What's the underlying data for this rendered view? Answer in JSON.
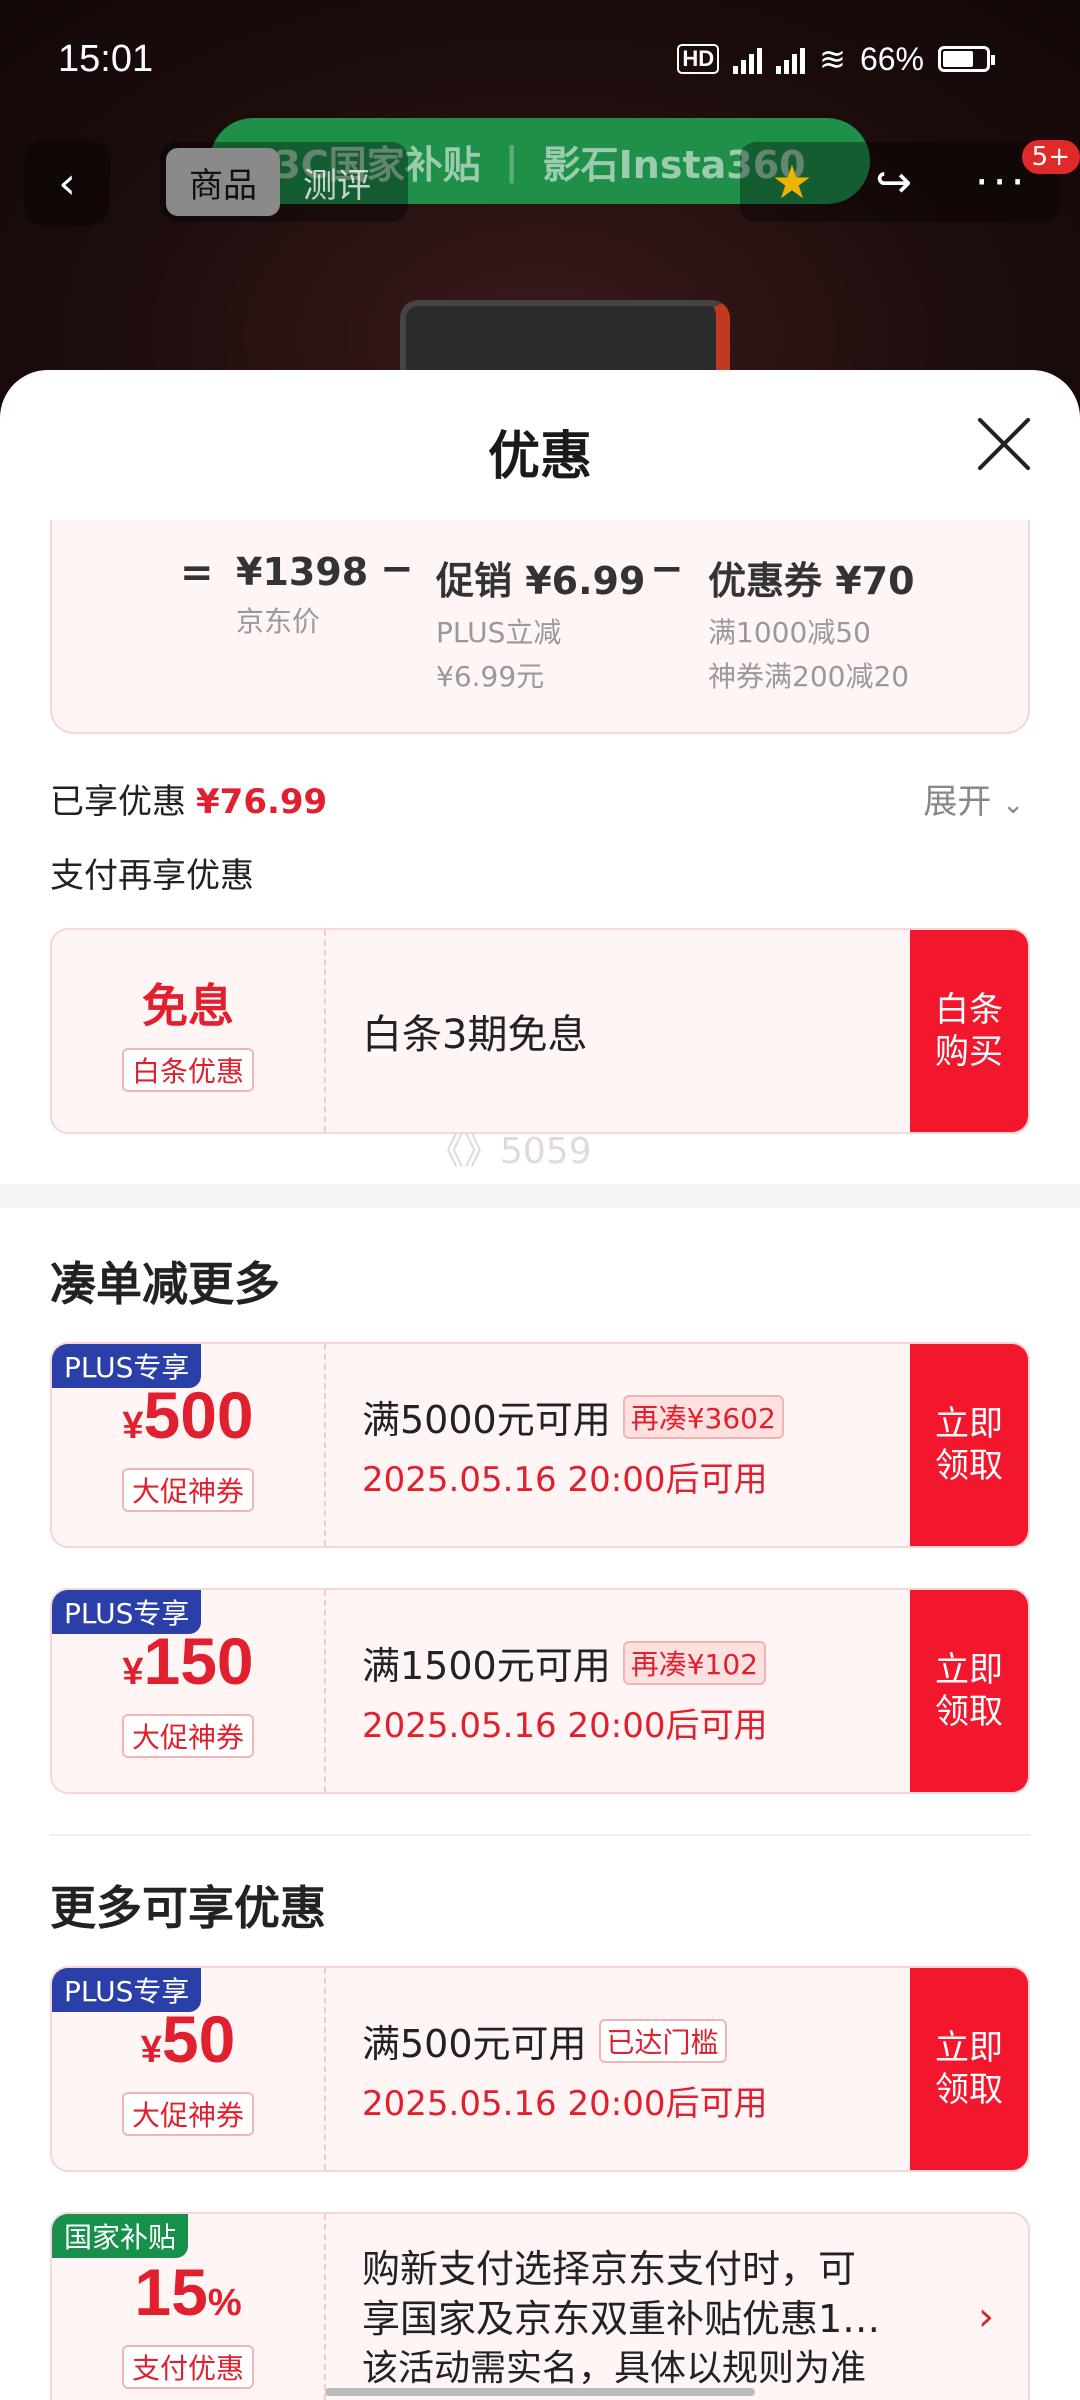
{
  "status_bar": {
    "time": "15:01",
    "battery": "66%"
  },
  "background": {
    "banner_left": "3C国家补贴",
    "banner_right": "影石Insta360",
    "tabs": [
      "商品",
      "测评"
    ],
    "badge": "5+"
  },
  "sheet": {
    "title": "优惠",
    "calc": {
      "eq": "=",
      "price": {
        "value": "¥1398",
        "label": "京东价"
      },
      "promo": {
        "value": "促销 ¥6.99",
        "label1": "PLUS立减",
        "label2": "¥6.99元"
      },
      "coupon": {
        "value": "优惠券 ¥70",
        "label1": "满1000减50",
        "label2": "神券满200减20"
      },
      "minus": "−"
    },
    "enjoyed": {
      "label": "已享优惠",
      "amount": "¥76.99",
      "expand": "展开"
    },
    "pay_title": "支付再享优惠",
    "baitiao": {
      "main": "免息",
      "tag": "白条优惠",
      "desc": "白条3期免息",
      "action": "白条购买"
    },
    "watermark": "《》5059",
    "section1": "凑单减更多",
    "coupons": [
      {
        "plus": "PLUS专享",
        "cur": "¥",
        "amount": "500",
        "tag": "大促神券",
        "cond": "满5000元可用",
        "extra": "再凑¥3602",
        "time": "2025.05.16 20:00后可用",
        "action": "立即领取"
      },
      {
        "plus": "PLUS专享",
        "cur": "¥",
        "amount": "150",
        "tag": "大促神券",
        "cond": "满1500元可用",
        "extra": "再凑¥102",
        "time": "2025.05.16 20:00后可用",
        "action": "立即领取"
      }
    ],
    "section2": "更多可享优惠",
    "coupon3": {
      "plus": "PLUS专享",
      "cur": "¥",
      "amount": "50",
      "tag": "大促神券",
      "cond": "满500元可用",
      "extra": "已达门槛",
      "time": "2025.05.16 20:00后可用",
      "action": "立即领取"
    },
    "subsidy": {
      "tag": "国家补贴",
      "amount": "15",
      "pct": "%",
      "sub": "支付优惠",
      "line1": "购新支付选择京东支付时，可",
      "line2": "享国家及京东双重补贴优惠1…",
      "line3": "该活动需实名，具体以规则为准"
    }
  },
  "colors": {
    "accent": "#f2172d",
    "plus": "#2a3fa8",
    "subsidy": "#16904a"
  }
}
